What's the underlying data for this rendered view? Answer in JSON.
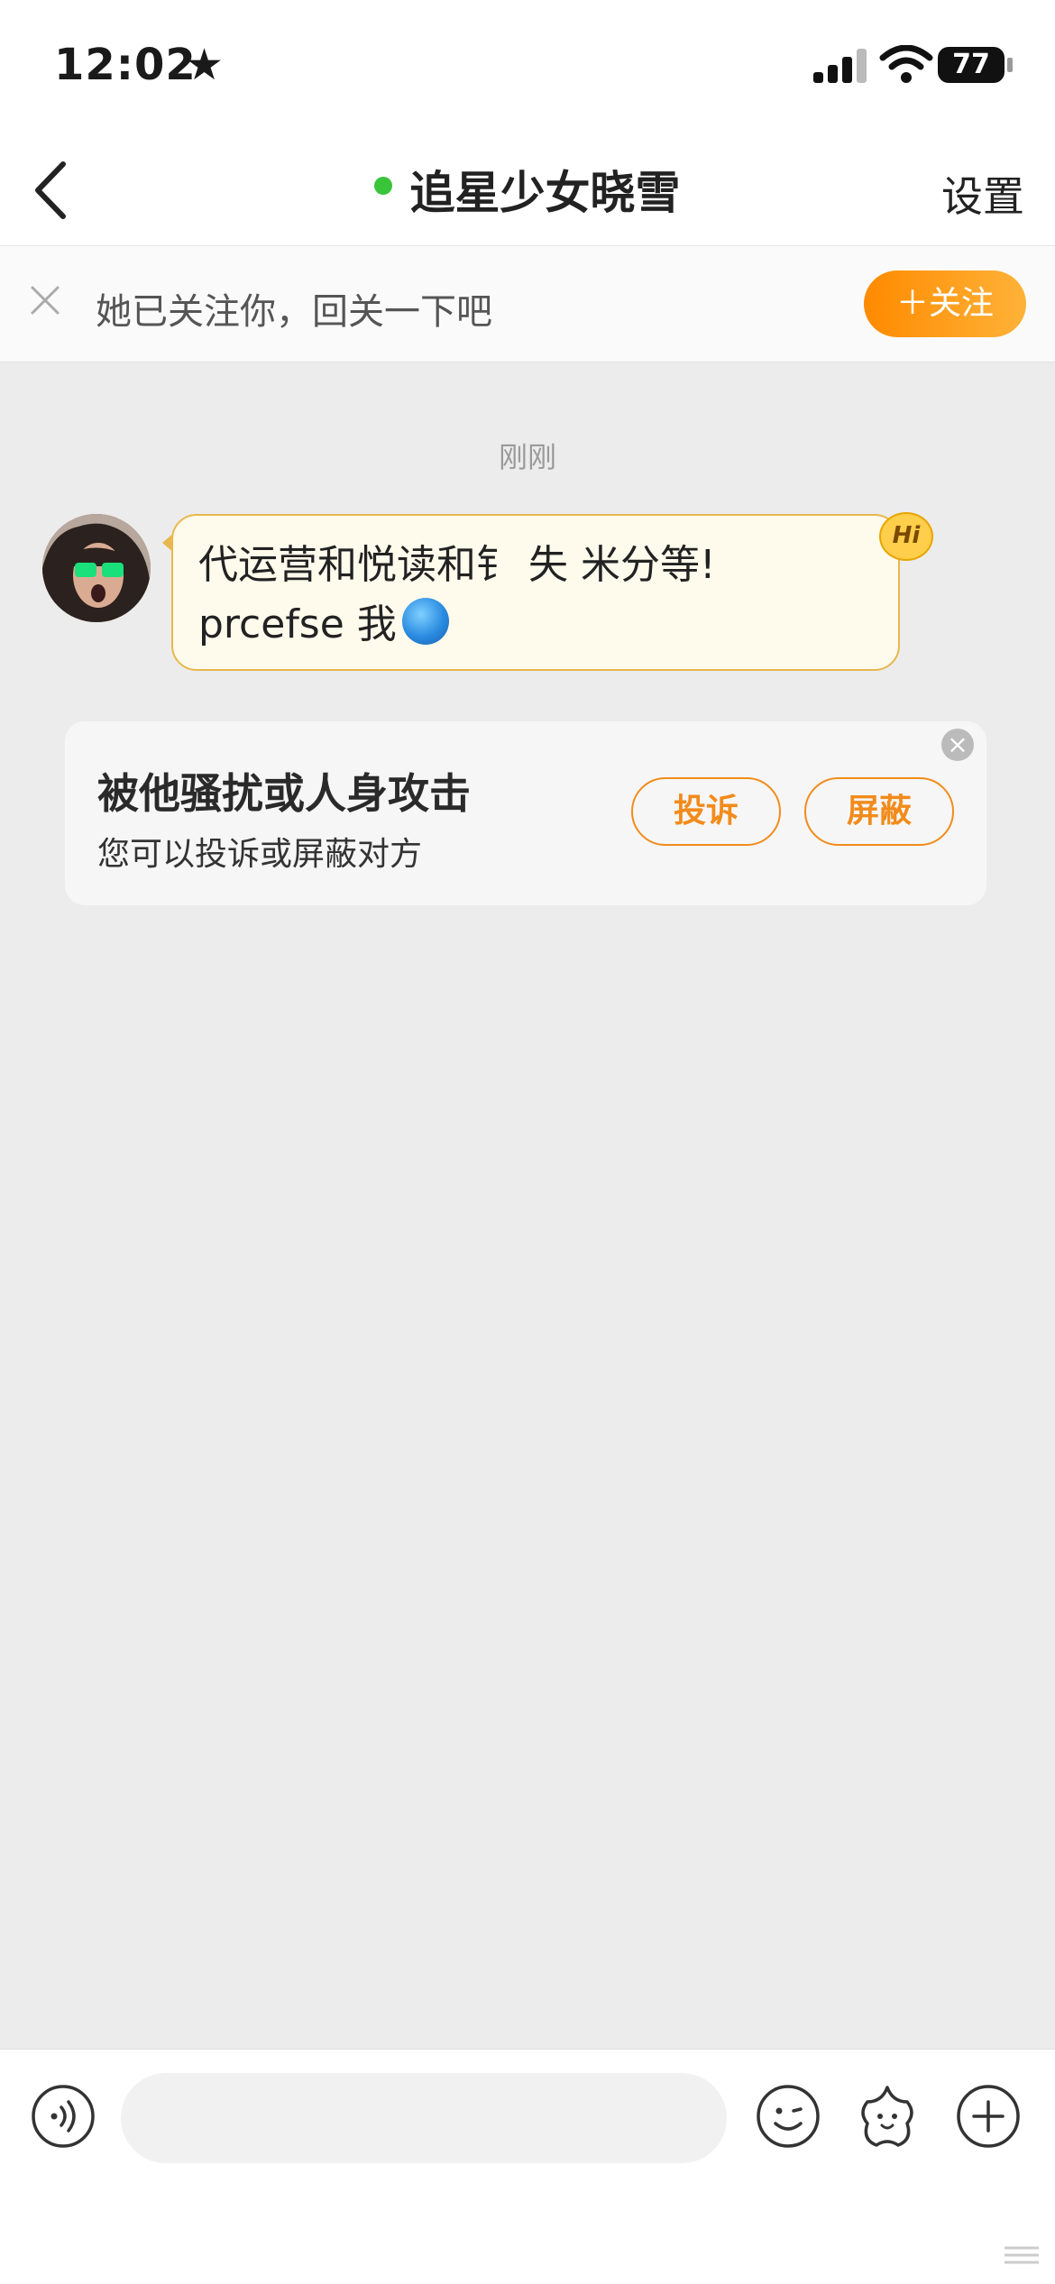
{
  "status_bar": {
    "time": "12:02",
    "battery": "77"
  },
  "nav": {
    "title": "追星少女晓雪",
    "settings_label": "设置"
  },
  "banner": {
    "text": "她已关注你，回关一下吧",
    "follow_label": "＋关注"
  },
  "chat": {
    "timestamp": "刚刚",
    "message": {
      "line1": "代运营和悦读和钅 失 米分等!",
      "line2": "prcefse 我"
    },
    "badge": "Hi"
  },
  "harassment_card": {
    "title": "被他骚扰或人身攻击",
    "subtitle": "您可以投诉或屏蔽对方",
    "report_label": "投诉",
    "block_label": "屏蔽"
  },
  "colors": {
    "accent": "#f28b1b",
    "online": "#3ac43a",
    "background": "#ececec"
  },
  "icons": [
    "back-icon",
    "close-icon",
    "voice-icon",
    "emoji-icon",
    "sticker-icon",
    "plus-icon",
    "globe-emoji"
  ]
}
